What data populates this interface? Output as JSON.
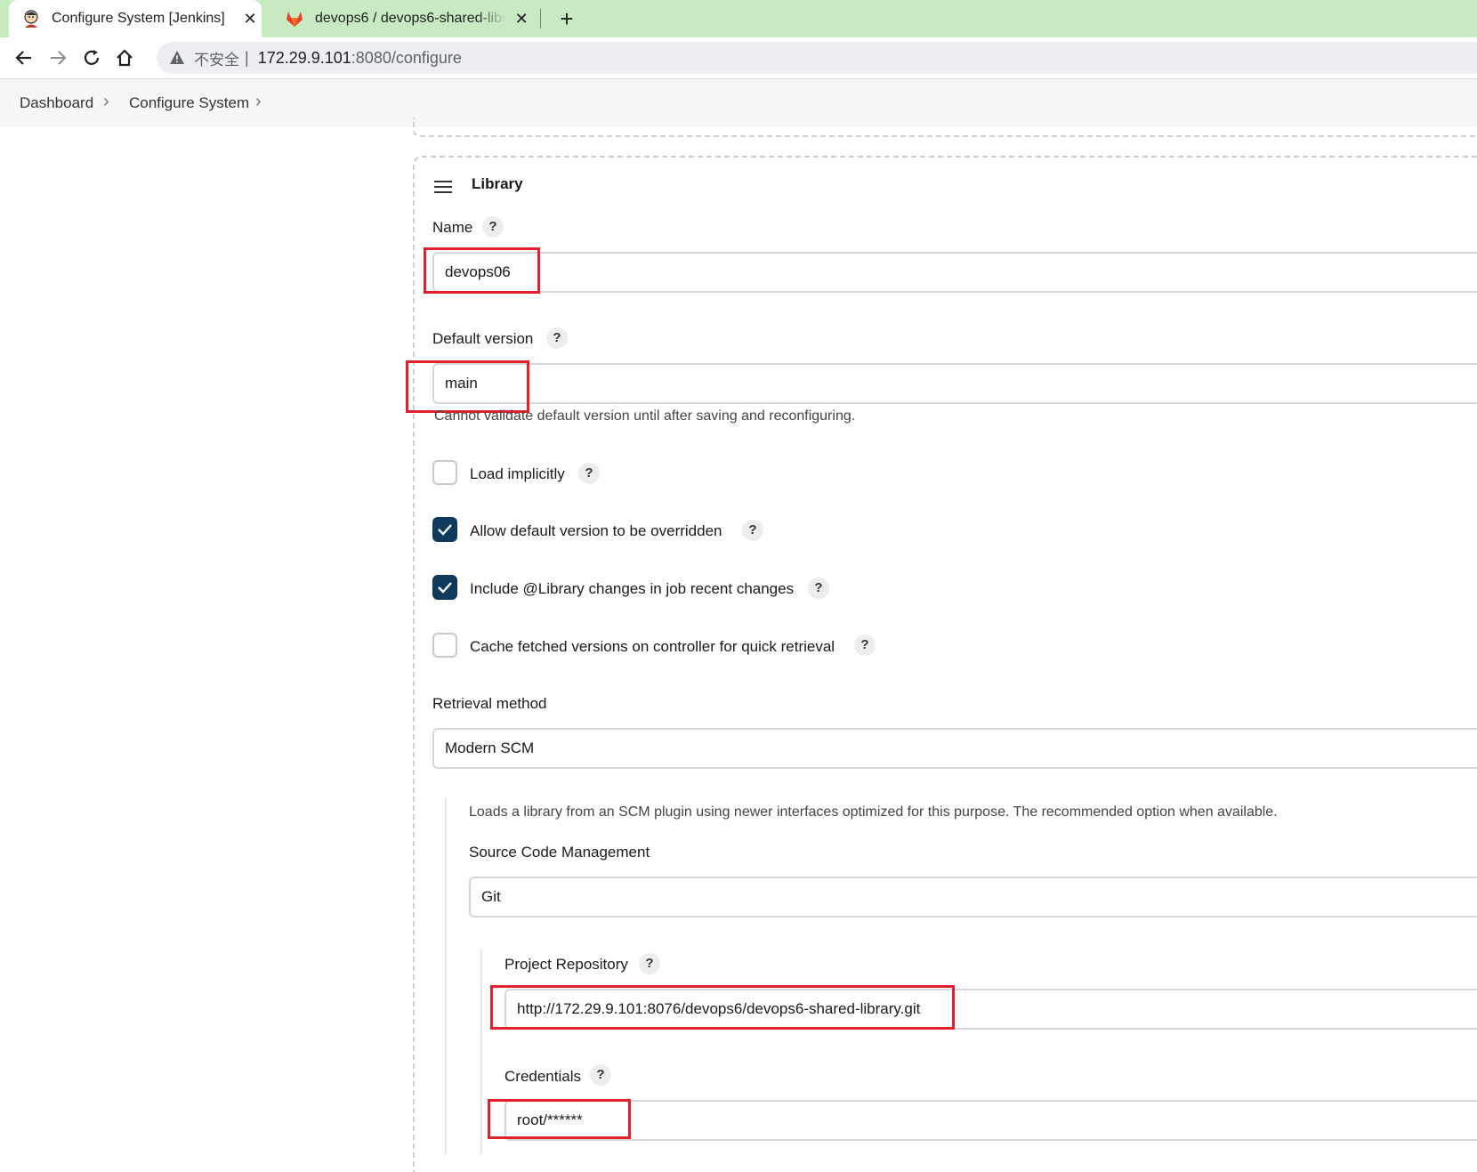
{
  "browser": {
    "tabs": [
      {
        "title": "Configure System [Jenkins]",
        "icon": "jenkins-icon",
        "active": true
      },
      {
        "title": "devops6 / devops6-shared-libr",
        "icon": "gitlab-icon",
        "active": false
      }
    ],
    "address": {
      "security_label": "不安全",
      "separator": "|",
      "host": "172.29.9.101",
      "path": ":8080/configure"
    }
  },
  "breadcrumb": {
    "items": [
      "Dashboard",
      "Configure System"
    ]
  },
  "library": {
    "section_title": "Library",
    "help_glyph": "?",
    "name": {
      "label": "Name",
      "value": "devops06"
    },
    "default_version": {
      "label": "Default version",
      "value": "main",
      "hint": "Cannot validate default version until after saving and reconfiguring."
    },
    "options": [
      {
        "label": "Load implicitly",
        "checked": false
      },
      {
        "label": "Allow default version to be overridden",
        "checked": true
      },
      {
        "label": "Include @Library changes in job recent changes",
        "checked": true
      },
      {
        "label": "Cache fetched versions on controller for quick retrieval",
        "checked": false
      }
    ],
    "retrieval_method": {
      "label": "Retrieval method",
      "value": "Modern SCM",
      "description": "Loads a library from an SCM plugin using newer interfaces optimized for this purpose. The recommended option when available."
    },
    "scm": {
      "label": "Source Code Management",
      "value": "Git"
    },
    "project_repository": {
      "label": "Project Repository",
      "value": "http://172.29.9.101:8076/devops6/devops6-shared-library.git"
    },
    "credentials": {
      "label": "Credentials",
      "value": "root/******"
    }
  },
  "colors": {
    "highlight": "#e3202b",
    "checkbox_checked": "#0f3a5e",
    "tabstrip": "#c8eac0"
  }
}
